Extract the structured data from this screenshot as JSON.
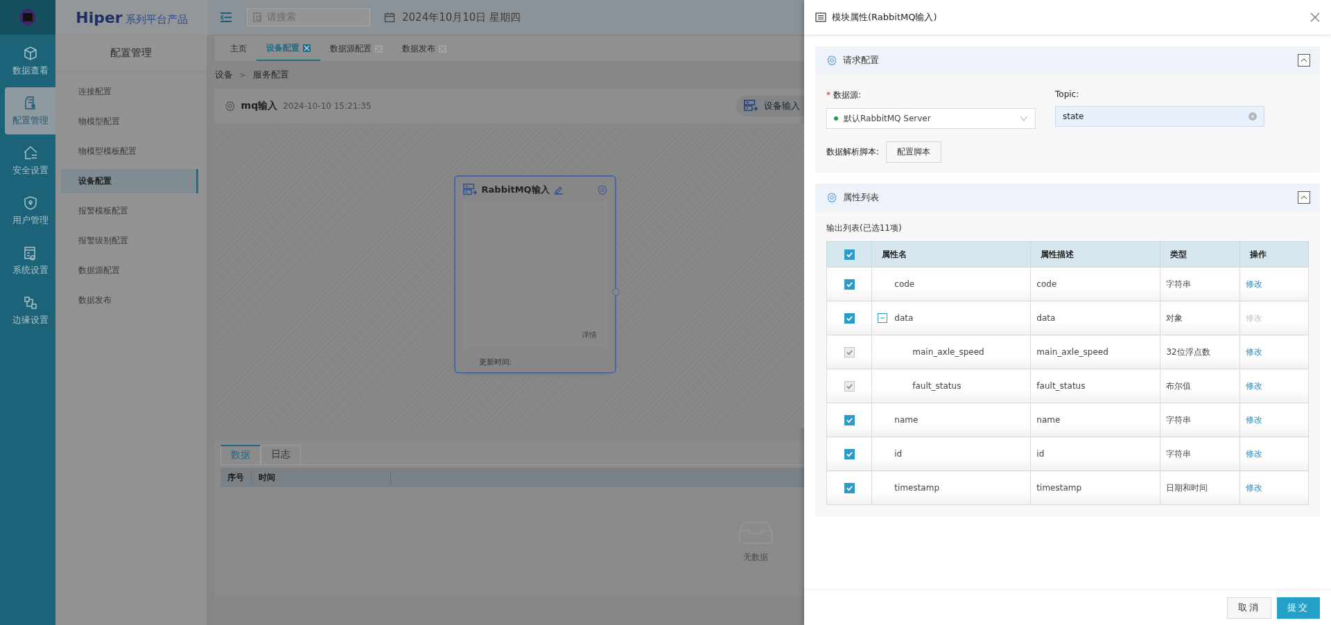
{
  "rail": {
    "items": [
      {
        "label": "数据查看",
        "selected": false
      },
      {
        "label": "配置管理",
        "selected": true
      },
      {
        "label": "安全设置",
        "selected": false
      },
      {
        "label": "用户管理",
        "selected": false
      },
      {
        "label": "系统设置",
        "selected": false
      },
      {
        "label": "边缘设置",
        "selected": false
      }
    ]
  },
  "brand": {
    "name": "Hiper",
    "tagline": "系列平台产品"
  },
  "header": {
    "search_placeholder": "请搜索",
    "date": "2024年10月10日 星期四"
  },
  "sidebar": {
    "title": "配置管理",
    "items": [
      {
        "label": "连接配置",
        "selected": false
      },
      {
        "label": "物模型配置",
        "selected": false
      },
      {
        "label": "物模型模板配置",
        "selected": false
      },
      {
        "label": "设备配置",
        "selected": true
      },
      {
        "label": "报警模板配置",
        "selected": false
      },
      {
        "label": "报警级别配置",
        "selected": false
      },
      {
        "label": "数据源配置",
        "selected": false
      },
      {
        "label": "数据发布",
        "selected": false
      }
    ]
  },
  "tabs": [
    {
      "label": "主页",
      "selected": false,
      "closable": false
    },
    {
      "label": "设备配置",
      "selected": true,
      "closable": true
    },
    {
      "label": "数据源配置",
      "selected": false,
      "closable": true
    },
    {
      "label": "数据发布",
      "selected": false,
      "closable": true
    }
  ],
  "breadcrumb": {
    "items": [
      "设备",
      "服务配置"
    ],
    "separator": ">"
  },
  "flow": {
    "title": "mq输入",
    "timestamp": "2024-10-10 15:21:35",
    "toolbar_button": "设备输入",
    "node": {
      "title": "RabbitMQ输入",
      "detail_link": "详情",
      "update_label": "更新时间:"
    }
  },
  "bottom_panel": {
    "tabs": [
      {
        "label": "数据",
        "selected": true
      },
      {
        "label": "日志",
        "selected": false
      }
    ],
    "columns": [
      "序号",
      "时间"
    ],
    "empty_text": "无数据"
  },
  "drawer": {
    "title": "模块属性(RabbitMQ输入)",
    "request_section": {
      "title": "请求配置",
      "expanded": true,
      "datasource": {
        "label": "数据源:",
        "required_mark": "*",
        "value": "默认RabbitMQ Server",
        "color": "#1e9e3e"
      },
      "topic": {
        "label": "Topic:",
        "value": "state"
      },
      "script": {
        "label": "数据解析脚本:",
        "button": "配置脚本"
      }
    },
    "attribute_section": {
      "title": "属性列表",
      "expanded": true,
      "summary": "输出列表(已选11项)",
      "all_checked": true,
      "columns": [
        "属性名",
        "属性描述",
        "类型",
        "操作"
      ],
      "rows": [
        {
          "name": "code",
          "description": "code",
          "type": "字符串",
          "action": "修改",
          "checked": true,
          "disabled": false,
          "action_disabled": false
        },
        {
          "name": "data",
          "description": "data",
          "type": "对象",
          "action": "修改",
          "checked": true,
          "disabled": false,
          "action_disabled": true,
          "expanded": true,
          "children": [
            {
              "name": "main_axle_speed",
              "description": "main_axle_speed",
              "type": "32位浮点数",
              "action": "修改",
              "checked": true,
              "disabled": true,
              "action_disabled": false
            },
            {
              "name": "fault_status",
              "description": "fault_status",
              "type": "布尔值",
              "action": "修改",
              "checked": true,
              "disabled": true,
              "action_disabled": false
            }
          ]
        },
        {
          "name": "name",
          "description": "name",
          "type": "字符串",
          "action": "修改",
          "checked": true,
          "disabled": false,
          "action_disabled": false
        },
        {
          "name": "id",
          "description": "id",
          "type": "字符串",
          "action": "修改",
          "checked": true,
          "disabled": false,
          "action_disabled": false
        },
        {
          "name": "timestamp",
          "description": "timestamp",
          "type": "日期和时间",
          "action": "修改",
          "checked": true,
          "disabled": false,
          "action_disabled": false
        }
      ]
    },
    "buttons": {
      "cancel": "取消",
      "submit": "提交"
    }
  }
}
